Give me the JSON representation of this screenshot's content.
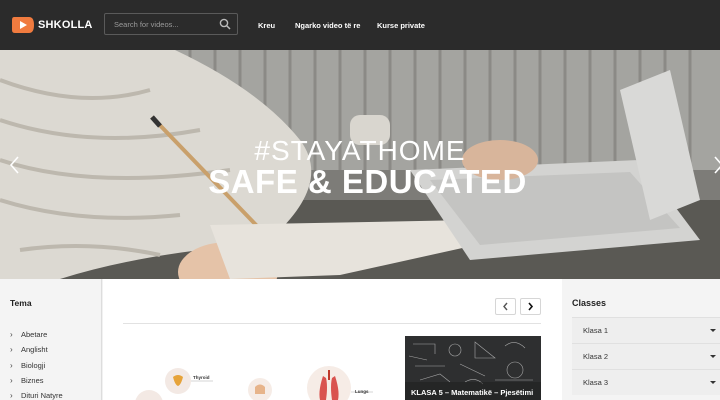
{
  "header": {
    "brand": "SHKOLLA",
    "search_placeholder": "Search for videos...",
    "nav": [
      "Kreu",
      "Ngarko video të re",
      "Kurse private"
    ]
  },
  "hero": {
    "line1": "#STAYATHOME",
    "line2": "SAFE & EDUCATED"
  },
  "topics": {
    "title": "Tema",
    "items": [
      "Abetare",
      "Anglisht",
      "Biologji",
      "Biznes",
      "Dituri Natyre"
    ]
  },
  "main": {
    "thumbs": [
      {
        "labels": [
          "Thyroid",
          "Lungs"
        ]
      },
      {
        "title": "KLASA 5 – Matematikë – Pjesëtimi"
      }
    ]
  },
  "classes": {
    "title": "Classes",
    "items": [
      "Klasa 1",
      "Klasa 2",
      "Klasa 3"
    ]
  },
  "colors": {
    "topbar": "#2b2b2b",
    "brand_accent": "#f07b3f"
  }
}
